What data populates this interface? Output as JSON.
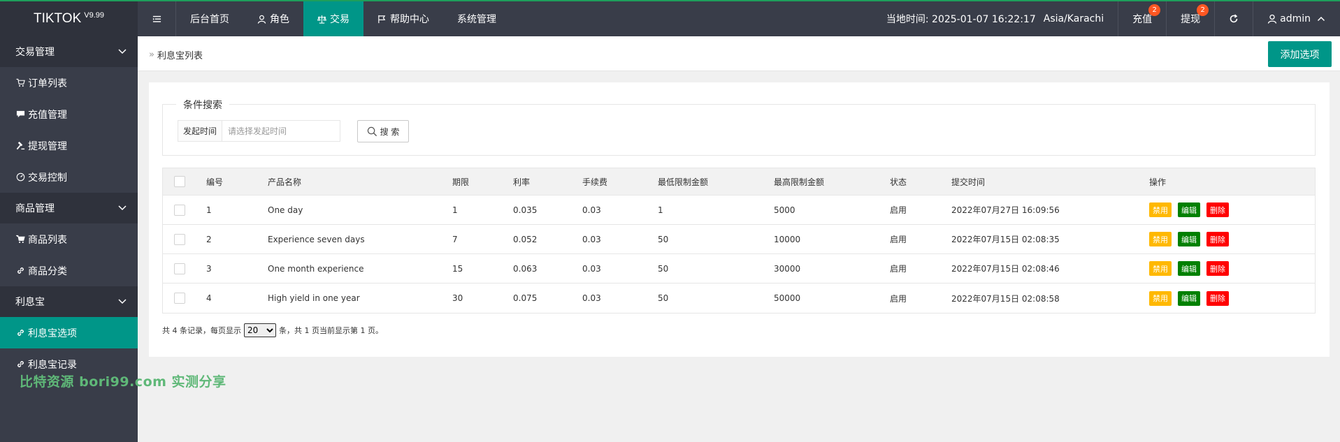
{
  "app": {
    "brand": "TIKTOK",
    "version": "V9.99"
  },
  "nav": {
    "items": [
      {
        "label": "后台首页"
      },
      {
        "label": "角色"
      },
      {
        "label": "交易"
      },
      {
        "label": "帮助中心"
      },
      {
        "label": "系统管理"
      }
    ]
  },
  "header_right": {
    "time_label": "当地时间: 2025-01-07 16:22:17",
    "timezone": "Asia/Karachi",
    "recharge_label": "充值",
    "recharge_badge": "2",
    "withdraw_label": "提现",
    "withdraw_badge": "2",
    "user": "admin"
  },
  "sidebar": {
    "groups": [
      {
        "label": "交易管理",
        "items": [
          "订单列表",
          "充值管理",
          "提现管理",
          "交易控制"
        ]
      },
      {
        "label": "商品管理",
        "items": [
          "商品列表",
          "商品分类"
        ]
      },
      {
        "label": "利息宝",
        "items": [
          "利息宝选项",
          "利息宝记录"
        ]
      }
    ],
    "watermark": "比特资源 bori99.com 实测分享"
  },
  "breadcrumb": {
    "current": "利息宝列表",
    "add_button": "添加选项"
  },
  "search": {
    "legend": "条件搜索",
    "date_label": "发起时间",
    "date_placeholder": "请选择发起时间",
    "button": "搜 索"
  },
  "table": {
    "headers": [
      "编号",
      "产品名称",
      "期限",
      "利率",
      "手续费",
      "最低限制金额",
      "最高限制金额",
      "状态",
      "提交时间",
      "操作"
    ],
    "rows": [
      {
        "id": "1",
        "name": "One day",
        "term": "1",
        "rate": "0.035",
        "fee": "0.03",
        "min": "1",
        "max": "5000",
        "status": "启用",
        "time": "2022年07月27日 16:09:56"
      },
      {
        "id": "2",
        "name": "Experience seven days",
        "term": "7",
        "rate": "0.052",
        "fee": "0.03",
        "min": "50",
        "max": "10000",
        "status": "启用",
        "time": "2022年07月15日 02:08:35"
      },
      {
        "id": "3",
        "name": "One month experience",
        "term": "15",
        "rate": "0.063",
        "fee": "0.03",
        "min": "50",
        "max": "30000",
        "status": "启用",
        "time": "2022年07月15日 02:08:46"
      },
      {
        "id": "4",
        "name": "High yield in one year",
        "term": "30",
        "rate": "0.075",
        "fee": "0.03",
        "min": "50",
        "max": "50000",
        "status": "启用",
        "time": "2022年07月15日 02:08:58"
      }
    ],
    "actions": {
      "disable": "禁用",
      "edit": "编辑",
      "delete": "删除"
    }
  },
  "pager": {
    "prefix": "共 4 条记录，每页显示",
    "page_size": "20",
    "suffix": "条，共 1 页当前显示第 1 页。"
  },
  "colors": {
    "accent": "#009688",
    "topbar": "#393d49",
    "warn": "#ffb800",
    "ok": "#008000",
    "danger": "#ff0000"
  }
}
